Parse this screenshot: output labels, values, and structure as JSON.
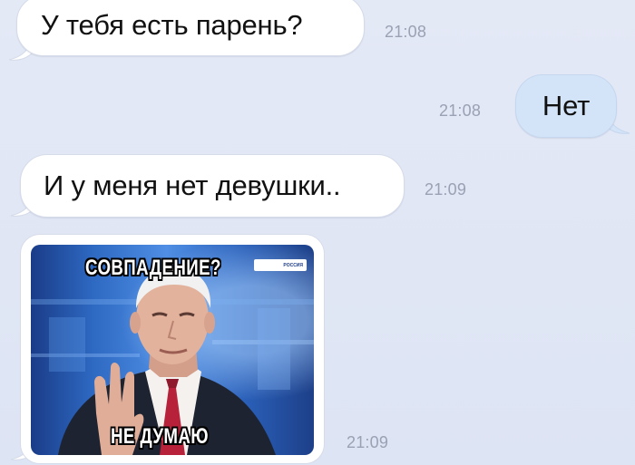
{
  "colors": {
    "background": "#e0e6f5",
    "incoming_bubble": "#ffffff",
    "outgoing_bubble": "#d4e4f8",
    "timestamp": "#9aa1b3"
  },
  "messages": [
    {
      "direction": "incoming",
      "text": "У тебя есть парень?",
      "time": "21:08"
    },
    {
      "direction": "outgoing",
      "text": "Нет",
      "time": "21:08"
    },
    {
      "direction": "incoming",
      "text": "И у меня нет девушки..",
      "time": "21:09"
    },
    {
      "direction": "incoming",
      "type": "image",
      "time": "21:09",
      "image": {
        "top_caption": "СОВПАДЕНИЕ?",
        "bottom_caption": "НЕ ДУМАЮ",
        "channel_logo_text": "РОССИЯ"
      }
    }
  ]
}
